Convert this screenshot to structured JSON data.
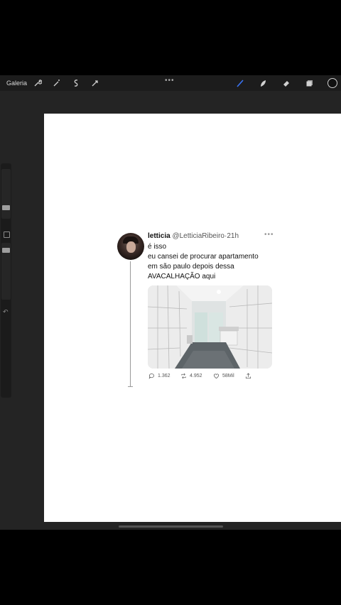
{
  "toolbar": {
    "gallery_label": "Galeria",
    "more_dots": "•••"
  },
  "sidebar": {
    "undo_glyph": "↶"
  },
  "tweet": {
    "display_name": "letticia",
    "handle": "@LetticiaRibeiro",
    "separator": "·",
    "time": "21h",
    "more": "•••",
    "lines": [
      "é isso",
      "eu cansei de procurar apartamento",
      "em são paulo depois dessa",
      "AVACALHAÇÃO aqui"
    ],
    "replies": "1.362",
    "retweets": "4.952",
    "likes": "58Mil"
  },
  "colors": {
    "app_bg": "#242424",
    "toolbar_bg": "#1c1c1c",
    "brush_accent": "#3a73f5"
  }
}
